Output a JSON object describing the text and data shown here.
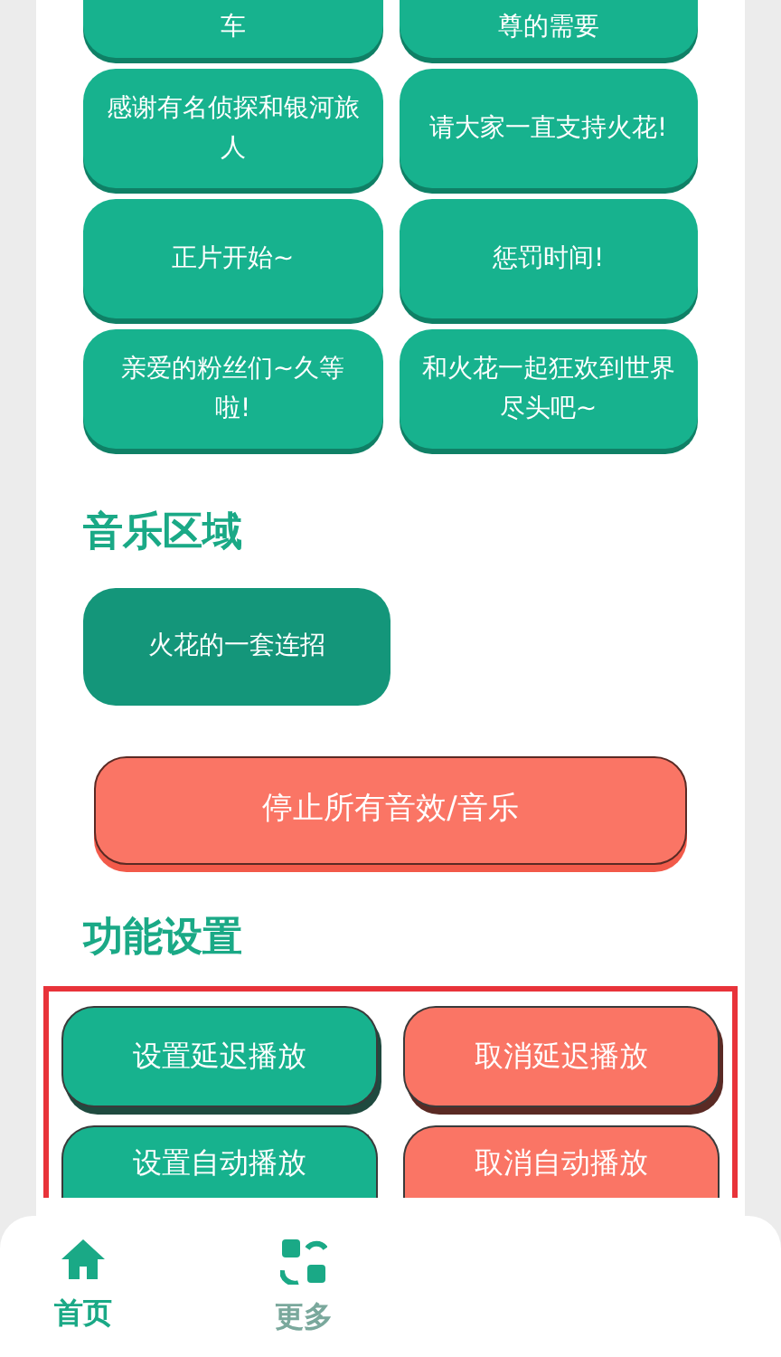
{
  "sound_buttons": [
    {
      "label": "车",
      "cut": true
    },
    {
      "label": "尊的需要",
      "cut": true
    },
    {
      "label": "感谢有名侦探和银河旅人",
      "cut": false
    },
    {
      "label": "请大家一直支持火花!",
      "cut": false
    },
    {
      "label": "正片开始~",
      "cut": false
    },
    {
      "label": "惩罚时间!",
      "cut": false
    },
    {
      "label": "亲爱的粉丝们~久等啦!",
      "cut": false
    },
    {
      "label": "和火花一起狂欢到世界尽头吧~",
      "cut": false
    }
  ],
  "music_section": {
    "title": "音乐区域",
    "buttons": [
      "火花的一套连招"
    ]
  },
  "stop_button": "停止所有音效/音乐",
  "settings_section": {
    "title": "功能设置",
    "highlighted": true,
    "buttons": [
      {
        "label": "设置延迟播放",
        "kind": "primary",
        "cut": false
      },
      {
        "label": "取消延迟播放",
        "kind": "danger",
        "cut": false
      },
      {
        "label": "设置自动播放",
        "kind": "primary",
        "cut": true
      },
      {
        "label": "取消自动播放",
        "kind": "danger",
        "cut": true
      }
    ]
  },
  "bottom_nav": [
    {
      "label": "首页",
      "kind": "home",
      "selected": true
    },
    {
      "label": "更多",
      "kind": "apps",
      "selected": false
    }
  ]
}
